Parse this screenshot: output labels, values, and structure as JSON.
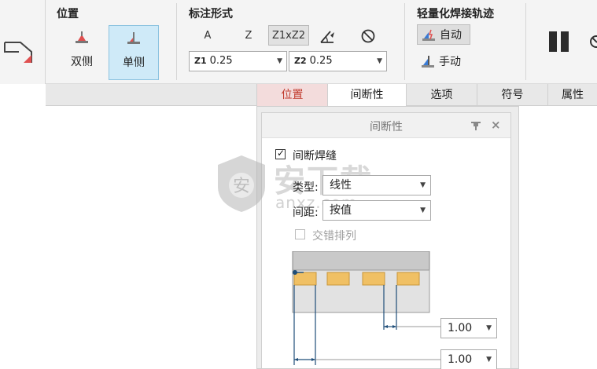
{
  "ribbon": {
    "placement_group": {
      "title": "位置",
      "both_sides_label": "双侧",
      "single_side_label": "单侧",
      "selected": "单侧"
    },
    "dimension_group": {
      "title": "标注形式",
      "modes": [
        "A",
        "Z",
        "Z1xZ2"
      ],
      "active_mode": "Z1xZ2",
      "z1": {
        "prefix": "Z1",
        "value": "0.25"
      },
      "z2": {
        "prefix": "Z2",
        "value": "0.25"
      }
    },
    "trajectory_group": {
      "title": "轻量化焊接轨迹",
      "auto_label": "自动",
      "manual_label": "手动",
      "selected": "自动"
    }
  },
  "tabs": {
    "items": [
      "位置",
      "间断性",
      "选项",
      "符号",
      "属性"
    ],
    "selected": "间断性"
  },
  "panel": {
    "title": "间断性",
    "intermittent_label": "间断焊缝",
    "intermittent_checked": true,
    "type_label": "类型:",
    "type_value": "线性",
    "pitch_label": "间距:",
    "pitch_value": "按值",
    "stagger_label": "交错排列",
    "stagger_checked": false,
    "stagger_enabled": false,
    "gap_value": "1.00",
    "length_value": "1.00"
  },
  "watermark": {
    "text": "安下载",
    "sub": "anxz.com",
    "shield_char": "安"
  },
  "colors": {
    "tab_position_bg": "#f3dcdc",
    "tab_position_text": "#c0392b",
    "active_button_bg": "#cfeaf8",
    "weld_fill": "#f0c064",
    "dimension_line": "#1f4e79"
  }
}
